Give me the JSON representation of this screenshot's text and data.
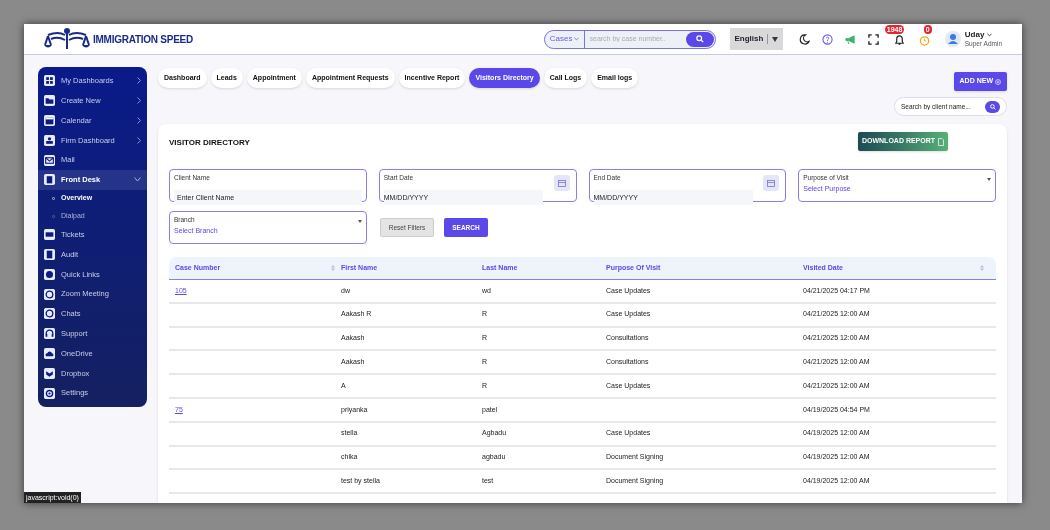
{
  "header": {
    "logo_text": "IMMIGRATION SPEED",
    "search": {
      "scope": "Cases",
      "placeholder": "search by case number.."
    },
    "language": "English",
    "notifications_count": "1948",
    "reminders_count": "0",
    "user": {
      "name": "Uday",
      "role": "Super Admin"
    }
  },
  "sidebar": {
    "items": [
      {
        "label": "My Dashboards",
        "has_arrow": true,
        "selected": false
      },
      {
        "label": "Create New",
        "has_arrow": true,
        "selected": false
      },
      {
        "label": "Calendar",
        "has_arrow": true,
        "selected": false
      },
      {
        "label": "Firm Dashboard",
        "has_arrow": true,
        "selected": false
      },
      {
        "label": "Mail",
        "has_arrow": false,
        "selected": false
      },
      {
        "label": "Front Desk",
        "has_arrow": true,
        "selected": true,
        "expanded": true,
        "children": [
          {
            "label": "Overview",
            "selected": true
          },
          {
            "label": "Dialpad",
            "selected": false
          }
        ]
      },
      {
        "label": "Tickets",
        "has_arrow": false,
        "selected": false
      },
      {
        "label": "Audit",
        "has_arrow": false,
        "selected": false
      },
      {
        "label": "Quick Links",
        "has_arrow": false,
        "selected": false
      },
      {
        "label": "Zoom Meeting",
        "has_arrow": false,
        "selected": false
      },
      {
        "label": "Chats",
        "has_arrow": false,
        "selected": false
      },
      {
        "label": "Support",
        "has_arrow": false,
        "selected": false
      },
      {
        "label": "OneDrive",
        "has_arrow": false,
        "selected": false
      },
      {
        "label": "Dropbox",
        "has_arrow": false,
        "selected": false
      },
      {
        "label": "Settings",
        "has_arrow": false,
        "selected": false
      }
    ]
  },
  "tabs": [
    {
      "label": "Dashboard",
      "selected": false
    },
    {
      "label": "Leads",
      "selected": false
    },
    {
      "label": "Appointment",
      "selected": false
    },
    {
      "label": "Appointment Requests",
      "selected": false
    },
    {
      "label": "Incentive Report",
      "selected": false
    },
    {
      "label": "Visitors Directory",
      "selected": true
    },
    {
      "label": "Call Logs",
      "selected": false
    },
    {
      "label": "Email logs",
      "selected": false
    }
  ],
  "add_new_button": "ADD NEW",
  "client_search": {
    "placeholder": "Search by client name..."
  },
  "panel": {
    "title": "VISITOR DIRECTORY",
    "download_button": "DOWNLOAD REPORT",
    "filters": [
      {
        "kind": "text",
        "label": "Client Name",
        "placeholder": "Enter Client Name"
      },
      {
        "kind": "date",
        "label": "Start Date",
        "placeholder": "MM/DD/YYYY"
      },
      {
        "kind": "date",
        "label": "End Date",
        "placeholder": "MM/DD/YYYY"
      },
      {
        "kind": "select",
        "label": "Purpose of Visit",
        "placeholder": "Select Purpose"
      },
      {
        "kind": "select",
        "label": "Branch",
        "placeholder": "Select Branch"
      }
    ],
    "reset_button": "Reset Filters",
    "search_button": "SEARCH"
  },
  "table": {
    "columns": [
      {
        "label": "Case Number",
        "sortable": true
      },
      {
        "label": "First Name",
        "sortable": false
      },
      {
        "label": "Last Name",
        "sortable": false
      },
      {
        "label": "Purpose Of Visit",
        "sortable": false
      },
      {
        "label": "Visited Date",
        "sortable": true
      }
    ],
    "rows": [
      [
        "105",
        "dw",
        "wd",
        "Case Updates",
        "04/21/2025 04:17 PM"
      ],
      [
        "",
        "Aakash R",
        "R",
        "Case Updates",
        "04/21/2025 12:00 AM"
      ],
      [
        "",
        "Aakash",
        "R",
        "Consultations",
        "04/21/2025 12:00 AM"
      ],
      [
        "",
        "Aakash",
        "R",
        "Consultations",
        "04/21/2025 12:00 AM"
      ],
      [
        "",
        "A",
        "R",
        "Case Updates",
        "04/21/2025 12:00 AM"
      ],
      [
        "75",
        "priyanka",
        "patel",
        "",
        "04/19/2025 04:54 PM"
      ],
      [
        "",
        "stella",
        "Agbadu",
        "Case Updates",
        "04/19/2025 12:00 AM"
      ],
      [
        "",
        "chika",
        "agbadu",
        "Document Signing",
        "04/19/2025 12:00 AM"
      ],
      [
        "",
        "test by stella",
        "test",
        "Document Signing",
        "04/19/2025 12:00 AM"
      ]
    ]
  },
  "status_bar": "javascript:void(0)"
}
